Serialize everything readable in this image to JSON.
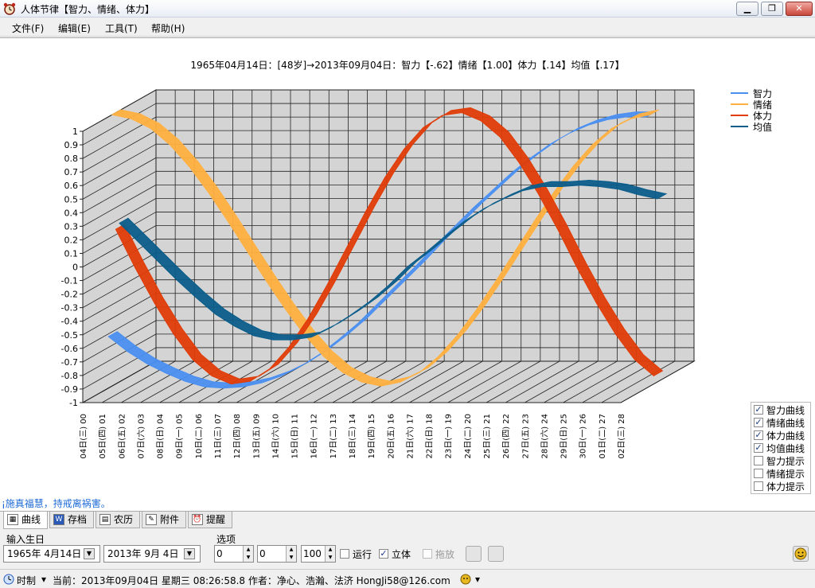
{
  "window": {
    "title": "人体节律【智力、情绪、体力】",
    "minimize": "▁",
    "maximize": "❐",
    "close": "✕"
  },
  "menu": [
    "文件(F)",
    "编辑(E)",
    "工具(T)",
    "帮助(H)"
  ],
  "chart_header": "1965年04月14日：[48岁]→2013年09月04日：智力【-.62】情绪【1.00】体力【.14】均值【.17】",
  "chart_data": {
    "type": "line",
    "style": "3d-ribbon",
    "ylim": [
      -1,
      1
    ],
    "y_ticks": [
      "1",
      "0.9",
      "0.8",
      "0.7",
      "0.6",
      "0.5",
      "0.4",
      "0.3",
      "0.2",
      "0.1",
      "0",
      "-0.1",
      "-0.2",
      "-0.3",
      "-0.4",
      "-0.5",
      "-0.6",
      "-0.7",
      "-0.8",
      "-0.9",
      "-1"
    ],
    "x_labels": [
      "04日(三) 00",
      "05日(四) 01",
      "06日(五) 02",
      "07日(六) 03",
      "08日(日) 04",
      "09日(一) 05",
      "10日(二) 06",
      "11日(三) 07",
      "12日(四) 08",
      "13日(五) 09",
      "14日(六) 10",
      "15日(日) 11",
      "16日(一) 12",
      "17日(二) 13",
      "18日(三) 14",
      "19日(四) 15",
      "20日(五) 16",
      "21日(六) 17",
      "22日(日) 18",
      "23日(一) 19",
      "24日(二) 20",
      "25日(三) 21",
      "26日(四) 22",
      "27日(五) 23",
      "28日(六) 24",
      "29日(日) 25",
      "30日(一) 26",
      "01日(二) 27",
      "02日(三) 28"
    ],
    "series": [
      {
        "name": "智力",
        "color": "#4a8ff0",
        "period": 33,
        "values": [
          -0.62,
          -0.73,
          -0.82,
          -0.89,
          -0.95,
          -0.99,
          -1.0,
          -0.99,
          -0.96,
          -0.91,
          -0.84,
          -0.75,
          -0.64,
          -0.52,
          -0.38,
          -0.24,
          -0.1,
          0.05,
          0.19,
          0.33,
          0.46,
          0.59,
          0.7,
          0.8,
          0.88,
          0.94,
          0.98,
          1.0,
          1.0
        ]
      },
      {
        "name": "情绪",
        "color": "#ffb040",
        "period": 28,
        "values": [
          1.0,
          0.97,
          0.9,
          0.78,
          0.62,
          0.43,
          0.22,
          0.0,
          -0.22,
          -0.43,
          -0.62,
          -0.78,
          -0.9,
          -0.97,
          -1.0,
          -0.97,
          -0.9,
          -0.78,
          -0.62,
          -0.43,
          -0.22,
          0.0,
          0.22,
          0.43,
          0.62,
          0.78,
          0.9,
          0.97,
          1.0
        ]
      },
      {
        "name": "体力",
        "color": "#e03c08",
        "period": 23,
        "values": [
          0.14,
          -0.14,
          -0.4,
          -0.63,
          -0.82,
          -0.94,
          -1.0,
          -0.98,
          -0.89,
          -0.73,
          -0.52,
          -0.27,
          0.0,
          0.27,
          0.52,
          0.73,
          0.89,
          0.98,
          1.0,
          0.94,
          0.82,
          0.63,
          0.4,
          0.14,
          -0.14,
          -0.4,
          -0.63,
          -0.82,
          -0.94
        ]
      },
      {
        "name": "均值",
        "color": "#0b5d8a",
        "values": [
          0.17,
          0.03,
          -0.11,
          -0.25,
          -0.38,
          -0.5,
          -0.59,
          -0.66,
          -0.69,
          -0.69,
          -0.67,
          -0.6,
          -0.51,
          -0.41,
          -0.29,
          -0.15,
          -0.04,
          0.08,
          0.19,
          0.28,
          0.35,
          0.41,
          0.44,
          0.44,
          0.45,
          0.44,
          0.42,
          0.38,
          0.35
        ]
      }
    ]
  },
  "legend": [
    {
      "label": "智力",
      "color": "#4a8ff0"
    },
    {
      "label": "情绪",
      "color": "#ffb040"
    },
    {
      "label": "体力",
      "color": "#e03c08"
    },
    {
      "label": "均值",
      "color": "#0b5d8a"
    }
  ],
  "options_panel": [
    {
      "label": "智力曲线",
      "checked": true
    },
    {
      "label": "情绪曲线",
      "checked": true
    },
    {
      "label": "体力曲线",
      "checked": true
    },
    {
      "label": "均值曲线",
      "checked": true
    },
    {
      "label": "智力提示",
      "checked": false
    },
    {
      "label": "情绪提示",
      "checked": false
    },
    {
      "label": "体力提示",
      "checked": false
    }
  ],
  "motto": "¡施真福慧，持戒离祸害。",
  "tabs": [
    {
      "label": "曲线",
      "icon": "chart-icon",
      "active": true
    },
    {
      "label": "存档",
      "icon": "word-doc-icon",
      "active": false
    },
    {
      "label": "农历",
      "icon": "calendar-icon",
      "active": false
    },
    {
      "label": "附件",
      "icon": "attachment-icon",
      "active": false
    },
    {
      "label": "提醒",
      "icon": "alarm-clock-icon",
      "active": false
    }
  ],
  "controls": {
    "birth_label": "输入生日",
    "birth_date": "1965年 4月14日",
    "target_date": "2013年 9月 4日",
    "options_label": "选项",
    "spin1": "0",
    "spin2": "0",
    "spin3": "100",
    "run_label": "运行",
    "run_checked": false,
    "stereo_label": "立体",
    "stereo_checked": true,
    "drag_label": "拖放",
    "drag_checked": false
  },
  "statusbar": {
    "clock_label": "时制",
    "text": "当前：2013年09月04日 星期三 08:26:58.8  作者：净心、浩瀚、法济  HongJi58@126.com"
  }
}
